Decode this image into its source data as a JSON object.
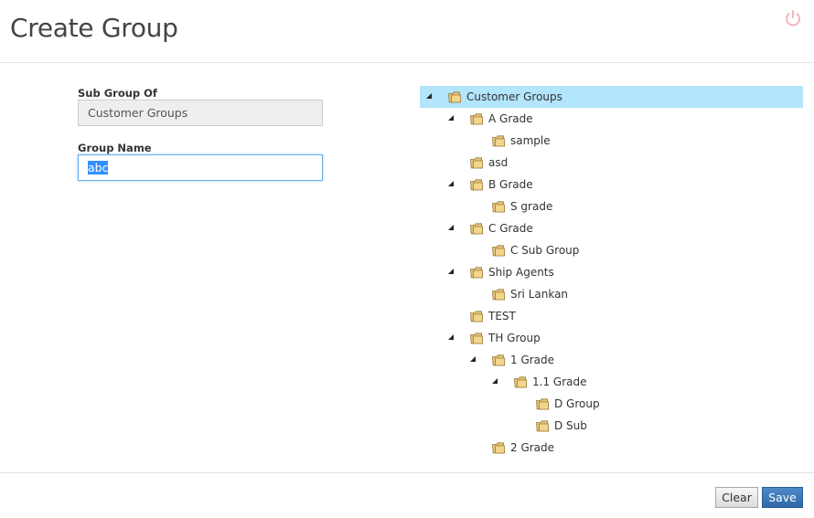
{
  "header": {
    "title": "Create Group"
  },
  "form": {
    "sub_group_label": "Sub Group Of",
    "sub_group_value": "Customer Groups",
    "group_name_label": "Group Name",
    "group_name_value": "abc"
  },
  "tree": {
    "nodes": [
      {
        "label": "Customer Groups",
        "expanded": true,
        "selected": true
      },
      {
        "label": "A Grade",
        "expanded": true
      },
      {
        "label": "sample"
      },
      {
        "label": "asd"
      },
      {
        "label": "B Grade",
        "expanded": true
      },
      {
        "label": "S grade"
      },
      {
        "label": "C Grade",
        "expanded": true
      },
      {
        "label": "C Sub Group"
      },
      {
        "label": "Ship Agents",
        "expanded": true
      },
      {
        "label": "Sri Lankan"
      },
      {
        "label": "TEST"
      },
      {
        "label": "TH Group",
        "expanded": true
      },
      {
        "label": "1 Grade",
        "expanded": true
      },
      {
        "label": "1.1 Grade",
        "expanded": true
      },
      {
        "label": "D Group"
      },
      {
        "label": "D Sub"
      },
      {
        "label": "2 Grade"
      }
    ]
  },
  "footer": {
    "clear_label": "Clear",
    "save_label": "Save"
  },
  "colors": {
    "selected_row": "#b3e5fc",
    "save_button": "#2f69a8",
    "input_focus": "#66afe9"
  }
}
